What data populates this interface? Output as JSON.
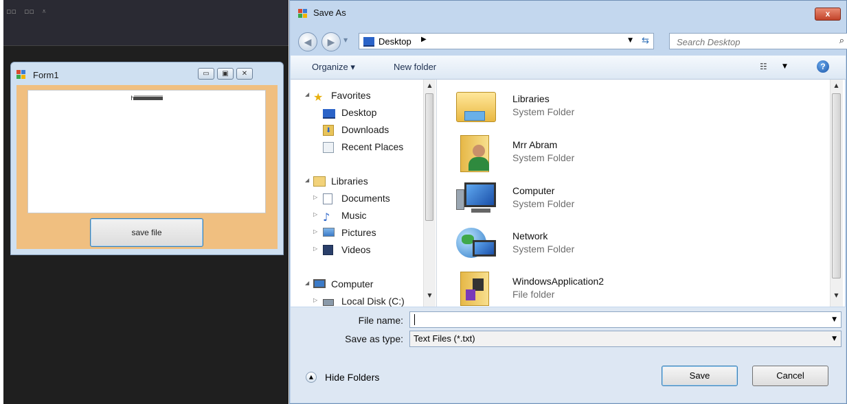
{
  "form1": {
    "title": "Form1",
    "textbox_value": "hiiiiiiiiiiiiiiiiiiiiiiiiiiiiiiiiiiiiiiiiii",
    "save_button_label": "save file",
    "caption_minimize": "▭",
    "caption_maximize": "▣",
    "caption_close": "✕"
  },
  "dialog": {
    "title": "Save As",
    "close_label": "x",
    "address": "Desktop",
    "search_placeholder": "Search Desktop",
    "toolbar": {
      "organize_label": "Organize ▾",
      "new_folder_label": "New folder",
      "help_label": "?"
    },
    "nav_tree": [
      {
        "label": "Favorites",
        "icon": "star-icon"
      },
      {
        "label": "Desktop",
        "icon": "desktop-icon"
      },
      {
        "label": "Downloads",
        "icon": "downloads-icon"
      },
      {
        "label": "Recent Places",
        "icon": "recent-places-icon"
      },
      {
        "label": "Libraries",
        "icon": "libraries-icon"
      },
      {
        "label": "Documents",
        "icon": "documents-icon"
      },
      {
        "label": "Music",
        "icon": "music-icon"
      },
      {
        "label": "Pictures",
        "icon": "pictures-icon"
      },
      {
        "label": "Videos",
        "icon": "videos-icon"
      },
      {
        "label": "Computer",
        "icon": "computer-icon"
      },
      {
        "label": "Local Disk (C:)",
        "icon": "local-disk-icon"
      }
    ],
    "items": [
      {
        "name": "Libraries",
        "type": "System Folder",
        "icon": "libraries-folder-icon"
      },
      {
        "name": "Mrr Abram",
        "type": "System Folder",
        "icon": "user-folder-icon"
      },
      {
        "name": "Computer",
        "type": "System Folder",
        "icon": "computer-icon"
      },
      {
        "name": "Network",
        "type": "System Folder",
        "icon": "network-icon"
      },
      {
        "name": "WindowsApplication2",
        "type": "File folder",
        "icon": "project-folder-icon"
      }
    ],
    "file_name_label": "File name:",
    "file_name_value": "",
    "save_type_label": "Save as type:",
    "save_type_value": "Text Files (*.txt)",
    "hide_folders_label": "Hide Folders",
    "save_button": "Save",
    "cancel_button": "Cancel"
  },
  "colors": {
    "form_client": "#f0bf80",
    "dialog_chrome": "#c3d7ee",
    "close_red": "#c2432a"
  }
}
